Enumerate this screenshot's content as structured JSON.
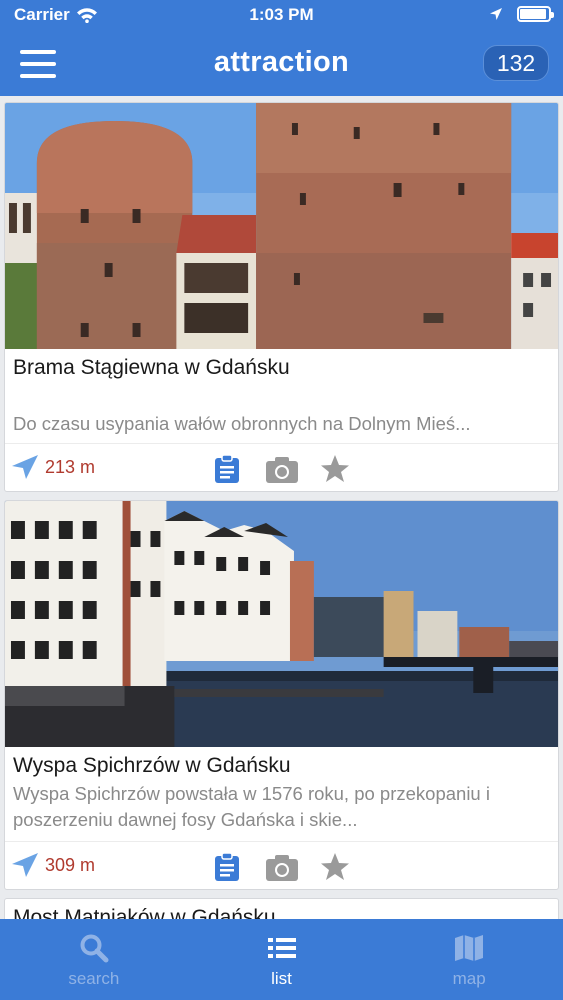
{
  "status_bar": {
    "carrier": "Carrier",
    "time": "1:03 PM",
    "battery_level": 0.85
  },
  "header": {
    "title": "attraction",
    "count": "132"
  },
  "cards": [
    {
      "title": "Brama Stągiewna w Gdańsku",
      "description": "Do czasu usypania wałów obronnych na Dolnym Mieś...",
      "distance": "213 m"
    },
    {
      "title": "Wyspa Spichrzów w Gdańsku",
      "description": "Wyspa Spichrzów powstała w 1576 roku, po przekopaniu i poszerzeniu dawnej fosy Gdańska i skie...",
      "distance": "309 m"
    },
    {
      "title": "Most Matniaków w Gdańsku"
    }
  ],
  "tabs": [
    {
      "label": "search",
      "icon": "search-icon"
    },
    {
      "label": "list",
      "icon": "list-icon"
    },
    {
      "label": "map",
      "icon": "map-icon"
    }
  ],
  "colors": {
    "primary": "#3b7bd6",
    "distance": "#b03a2e",
    "action_active": "#3b7bd6",
    "action_inactive": "#9a9a9a"
  }
}
